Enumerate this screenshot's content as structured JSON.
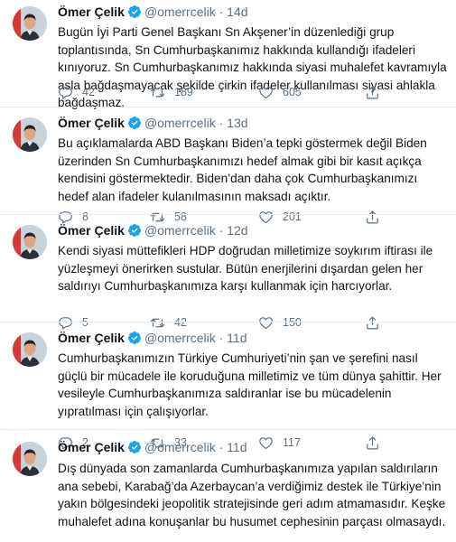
{
  "author": {
    "name": "Ömer Çelik",
    "handle": "@omerrcelik",
    "dot": "·"
  },
  "tweets": [
    {
      "time": "14d",
      "text": "Bugün İyi Parti Genel Başkanı Sn Akşener’in düzenlediği grup toplantısında, Sn Cumhurbaşkanımız hakkında kullandığı ifadeleri kınıyoruz. Sn Cumhurbaşkanımız hakkında siyasi muhalefet kavramıyla asla bağdaşmayacak şekilde çirkin ifadeler kullanılması siyasi ahlakla bağdaşmaz.",
      "replies": "42",
      "retweets": "189",
      "likes": "605"
    },
    {
      "time": "13d",
      "text": "Bu açıklamalarda ABD Başkanı Biden’a tepki göstermek değil Biden üzerinden Sn Cumhurbaşkanımızı hedef almak gibi bir kasıt açıkça kendisini göstermektedir. Biden’dan daha çok Cumhurbaşkanımızı hedef alan ifadeler kulanılmasının maksadı açıktır.",
      "replies": "8",
      "retweets": "58",
      "likes": "201"
    },
    {
      "time": "12d",
      "text": "Kendi siyasi müttefikleri HDP doğrudan milletimize soykırım iftirası ile yüzleşmeyi önerirken sustular. Bütün enerjilerini dışardan gelen her saldırıyı Cumhurbaşkanımıza karşı kullanmak için harcıyorlar.",
      "replies": "5",
      "retweets": "42",
      "likes": "150"
    },
    {
      "time": "11d",
      "text": "Cumhurbaşkanımızın Türkiye Cumhuriyeti’nin şan ve şerefini nasıl güçlü bir mücadele ile koruduğuna milletimiz ve tüm dünya şahittir. Her vesileyle Cumhurbaşkanımıza saldıranlar ise bu mücadelenin yıpratılması için çalışıyorlar.",
      "replies": "2",
      "retweets": "33",
      "likes": "117"
    },
    {
      "time": "11d",
      "text": "Dış dünyada son zamanlarda Cumhurbaşkanımıza yapılan saldırıların ana sebebi, Karabağ’da Azerbaycan’a verdiğimiz destek ile Türkiye’nin yakın bölgesindeki jeopolitik stratejisinde geri adım atmamasıdır. Keşke muhalefet adına konuşanlar bu husumet cephesinin parçası olmasaydı.",
      "replies": "",
      "retweets": "",
      "likes": ""
    }
  ],
  "icons": {
    "reply": "reply-icon",
    "retweet": "retweet-icon",
    "like": "heart-icon",
    "share": "share-icon",
    "verified": "verified-badge-icon"
  },
  "colors": {
    "verified": "#1da1f2",
    "secondary_text": "#5b7083",
    "divider": "#e6ecf0"
  }
}
